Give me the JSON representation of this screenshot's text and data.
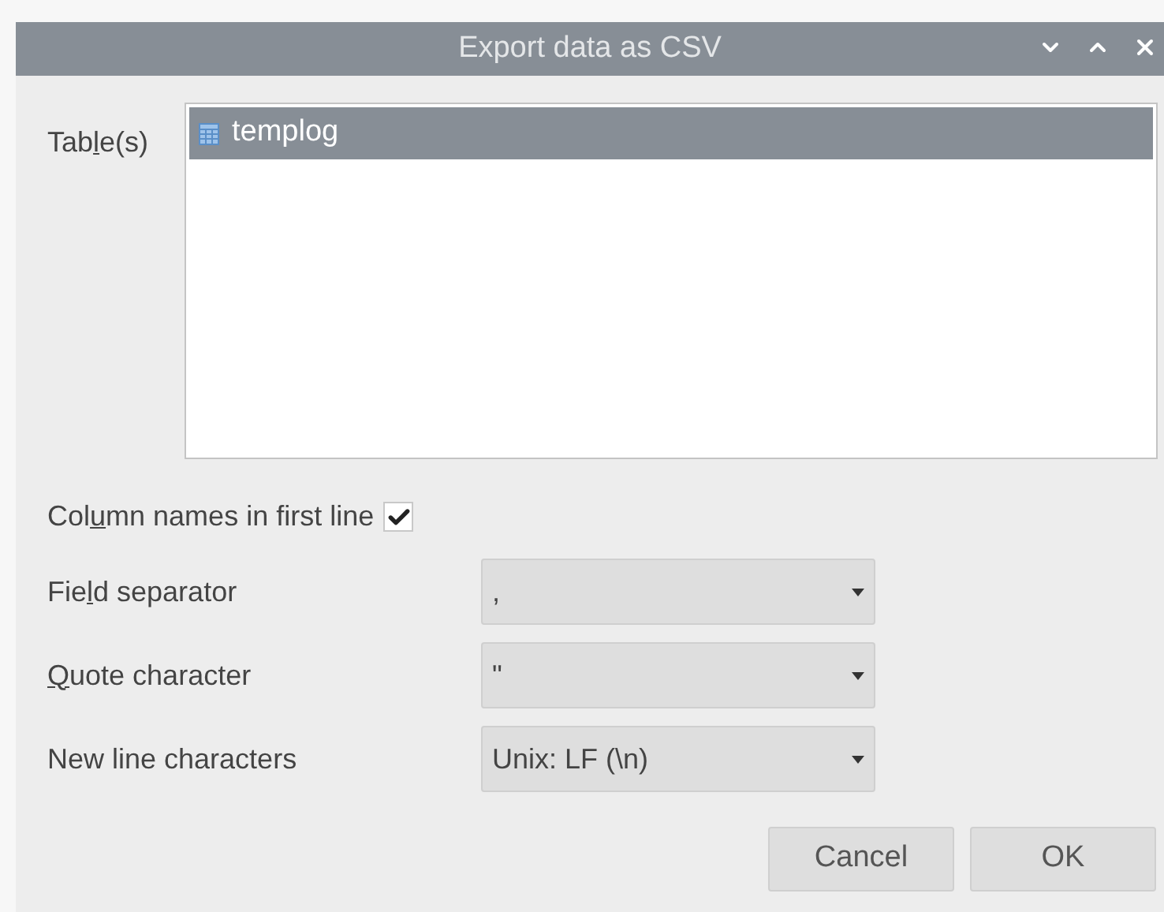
{
  "window": {
    "title": "Export data as CSV"
  },
  "tables": {
    "label": {
      "before": "Tab",
      "mnemonic": "l",
      "after": "e(s)"
    },
    "items": [
      {
        "name": "templog",
        "selected": true
      }
    ]
  },
  "column_names": {
    "label": {
      "before": "Col",
      "mnemonic": "u",
      "after": "mn names in first line"
    },
    "checked": true
  },
  "fields": [
    {
      "label": {
        "before": "Fie",
        "mnemonic": "l",
        "after": "d separator"
      },
      "value": ","
    },
    {
      "label": {
        "mnemonic": "Q",
        "after": "uote character"
      },
      "value": "\""
    },
    {
      "label": {
        "before": "New line characters"
      },
      "value": "Unix: LF (\\n)"
    }
  ],
  "buttons": [
    "Cancel",
    "OK"
  ]
}
